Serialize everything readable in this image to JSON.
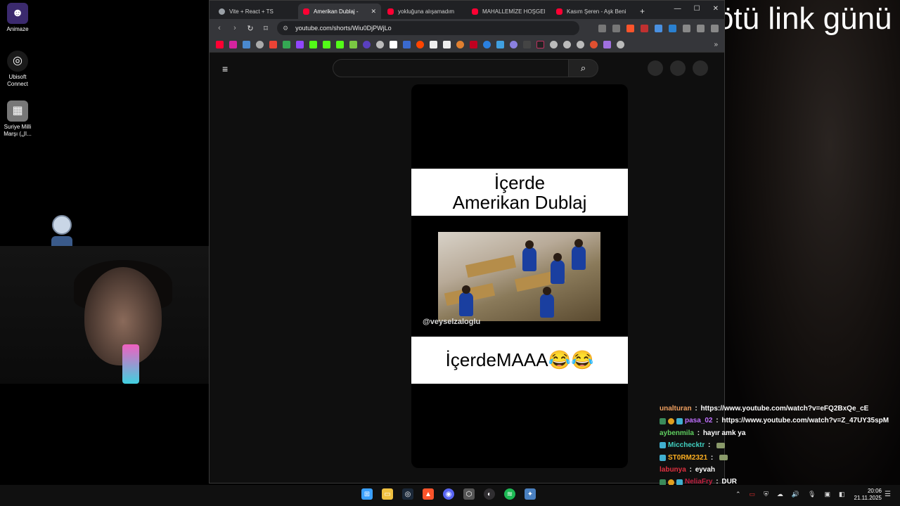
{
  "overlay": {
    "title": "kötü link günü"
  },
  "desktop": {
    "icons": [
      {
        "label": "Animaze",
        "color": "#3b2a6e",
        "icon": "animaze-icon"
      },
      {
        "label": "Ubisoft Connect",
        "color": "#ffffff",
        "icon": "ubisoft-icon"
      },
      {
        "label": "Suriye Milli Marşı (ال...",
        "color": "#888888",
        "icon": "video-file-icon"
      }
    ]
  },
  "browser": {
    "tabs": [
      {
        "label": "Vite + React + TS",
        "favicon": "vite"
      },
      {
        "label": "Amerikan Dublaj - ",
        "favicon": "yt",
        "active": true
      },
      {
        "label": "yokluğuna alışamadım ",
        "favicon": "yt"
      },
      {
        "label": "MAHALLEMİZE HOŞGEL",
        "favicon": "yt"
      },
      {
        "label": "Kasım Şeren - Aşk Beni",
        "favicon": "yt"
      }
    ],
    "close_glyph": "✕",
    "new_tab_glyph": "+",
    "window_controls": {
      "minimize": "—",
      "maximize": "☐",
      "close": "✕"
    },
    "url": "youtube.com/shorts/Wiu0DjPWjLo",
    "nav": {
      "back": "‹",
      "forward": "›",
      "reload": "↻",
      "bookmark": "⌑"
    },
    "bookmarks_more": "»"
  },
  "youtube": {
    "search_placeholder": "",
    "search_glyph": "⌕",
    "menu_glyph": "≡"
  },
  "short": {
    "caption_top_line1": "İçerde",
    "caption_top_line2": "Amerikan Dublaj",
    "watermark": "@veyselzaloglu",
    "caption_bottom": "İçerdeMAAA😂😂"
  },
  "chat": [
    {
      "user": "unalturan",
      "color": "#f0a060",
      "badges": [],
      "text": "https://www.youtube.com/watch?v=eFQ2BxQe_cE"
    },
    {
      "user": "pasa_02",
      "color": "#c070ff",
      "badges": [
        "#3a8a5a",
        "#e0a020",
        "#40b0d0"
      ],
      "text": "https://www.youtube.com/watch?v=Z_47UY35spM"
    },
    {
      "user": "aybenmila",
      "color": "#60d060",
      "badges": [],
      "text": "hayır amk ya"
    },
    {
      "user": "Miccheckt​r",
      "color": "#40d0c0",
      "badges": [
        "#40b0d0"
      ],
      "text": "",
      "emote": true
    },
    {
      "user": "ST0RM2321",
      "color": "#ffb020",
      "badges": [
        "#40b0d0"
      ],
      "text": "",
      "emote": true
    },
    {
      "user": "labunya",
      "color": "#e03040",
      "badges": [],
      "text": "eyvah"
    },
    {
      "user": "NeliaFry",
      "color": "#c02040",
      "badges": [
        "#3a8a5a",
        "#e0a020",
        "#40b0d0"
      ],
      "text": "DUR"
    }
  ],
  "taskbar": {
    "apps": [
      {
        "name": "windows-start-icon",
        "color": "#3aa0ff",
        "glyph": "⊞"
      },
      {
        "name": "file-explorer-icon",
        "color": "#f0c040",
        "glyph": "▭"
      },
      {
        "name": "steam-icon",
        "color": "#1b2838",
        "glyph": "◎"
      },
      {
        "name": "brave-icon",
        "color": "#fb542b",
        "glyph": "▲"
      },
      {
        "name": "discord-icon",
        "color": "#5865f2",
        "glyph": "◉"
      },
      {
        "name": "app-cube-icon",
        "color": "#555555",
        "glyph": "⬡"
      },
      {
        "name": "obs-icon",
        "color": "#302e31",
        "glyph": "◐"
      },
      {
        "name": "spotify-icon",
        "color": "#1db954",
        "glyph": "≋"
      },
      {
        "name": "app-settings-icon",
        "color": "#4a80c0",
        "glyph": "✦"
      }
    ],
    "tray": [
      "⌃",
      "▭",
      "⛨",
      "☁",
      "🔊",
      "🎙",
      "▣",
      "◧"
    ],
    "time": "20:06",
    "date": "21.11.2025",
    "notification_glyph": "☰"
  }
}
